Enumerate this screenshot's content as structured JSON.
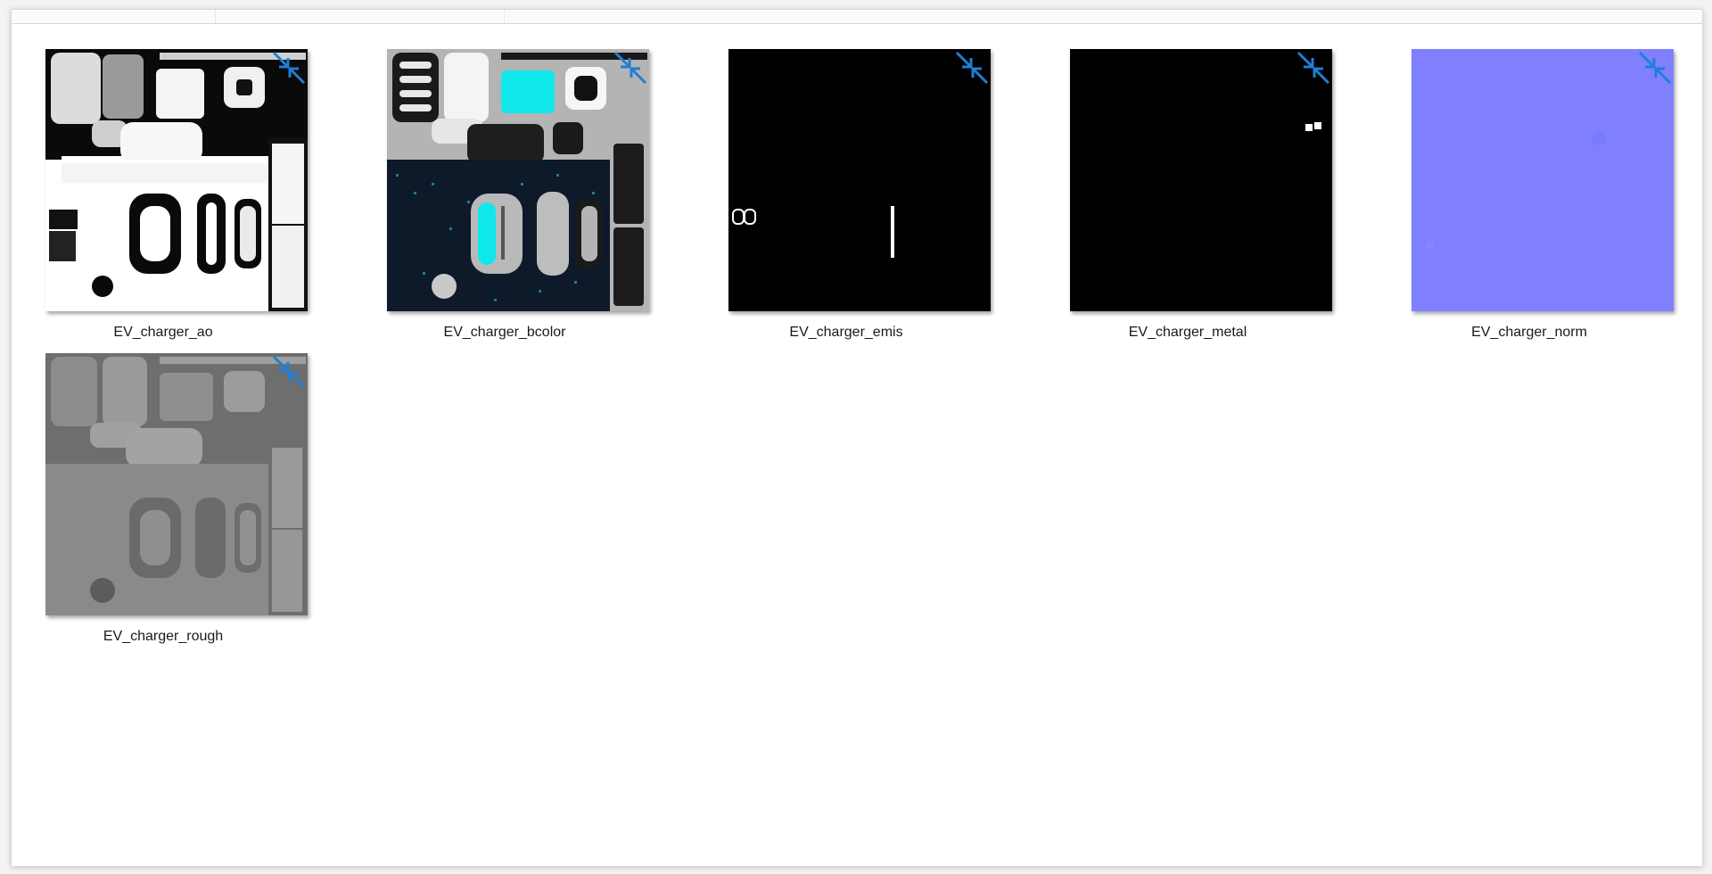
{
  "window": {
    "background": "#ffffff"
  },
  "files": [
    {
      "name": "EV_charger_ao",
      "kind": "ambient-occlusion",
      "base_color": "#ffffff"
    },
    {
      "name": "EV_charger_bcolor",
      "kind": "base-color",
      "base_color": "#b4b4b4"
    },
    {
      "name": "EV_charger_emis",
      "kind": "emissive",
      "base_color": "#000000"
    },
    {
      "name": "EV_charger_metal",
      "kind": "metallic",
      "base_color": "#000000"
    },
    {
      "name": "EV_charger_norm",
      "kind": "normal",
      "base_color": "#8080ff"
    },
    {
      "name": "EV_charger_rough",
      "kind": "roughness",
      "base_color": "#7a7a7a"
    }
  ],
  "overlay_icon": {
    "name": "shortcut-compress-arrows-icon",
    "color": "#1e7fd6"
  }
}
